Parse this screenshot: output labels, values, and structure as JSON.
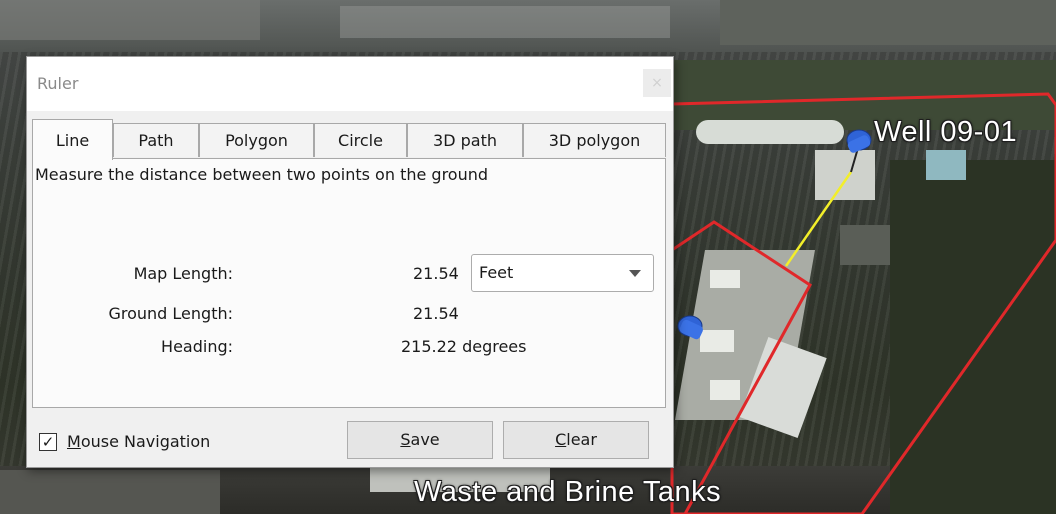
{
  "map": {
    "labels": [
      "Well 09-01",
      "Waste and Brine Tanks"
    ],
    "colors": {
      "boundary": "#e0282a",
      "measure_line": "#f2ee2a",
      "pin": "#2f63d6"
    }
  },
  "dialog": {
    "title": "Ruler",
    "close_icon": "close-icon",
    "tabs": [
      "Line",
      "Path",
      "Polygon",
      "Circle",
      "3D path",
      "3D polygon"
    ],
    "active_tab": "Line",
    "description": "Measure the distance between two points on the ground",
    "map_length_label": "Map Length:",
    "map_length_value": "21.54",
    "unit_selected": "Feet",
    "ground_length_label": "Ground Length:",
    "ground_length_value": "21.54",
    "heading_label": "Heading:",
    "heading_value": "215.22 degrees",
    "mouse_nav_checked": true,
    "mouse_nav_prefix": "M",
    "mouse_nav_rest": "ouse Navigation",
    "save_prefix": "S",
    "save_rest": "ave",
    "clear_prefix": "C",
    "clear_rest": "lear"
  }
}
